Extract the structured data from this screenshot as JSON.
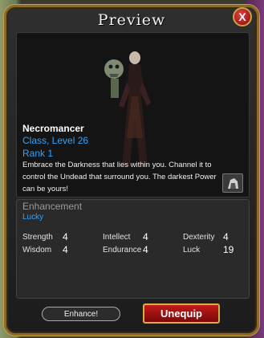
{
  "window": {
    "title": "Preview",
    "close_label": "X"
  },
  "item": {
    "name": "Necromancer",
    "type_level": "Class, Level 26",
    "rank": "Rank 1",
    "description": "Embrace the Darkness that lies within you. Channel it to control the Undead that surround you. The darkest Power can be yours!"
  },
  "enhancement": {
    "title": "Enhancement",
    "value": "Lucky",
    "stats": [
      {
        "name": "Strength",
        "value": "4"
      },
      {
        "name": "Intellect",
        "value": "4"
      },
      {
        "name": "Dexterity",
        "value": "4"
      },
      {
        "name": "Wisdom",
        "value": "4"
      },
      {
        "name": "Endurance",
        "value": "4"
      },
      {
        "name": "Luck",
        "value": "19"
      }
    ]
  },
  "buttons": {
    "enhance": "Enhance!",
    "unequip": "Unequip"
  },
  "colors": {
    "accent_blue": "#2fa3ff",
    "unequip_red": "#c41a1a",
    "frame_gold": "#c9a24a"
  }
}
